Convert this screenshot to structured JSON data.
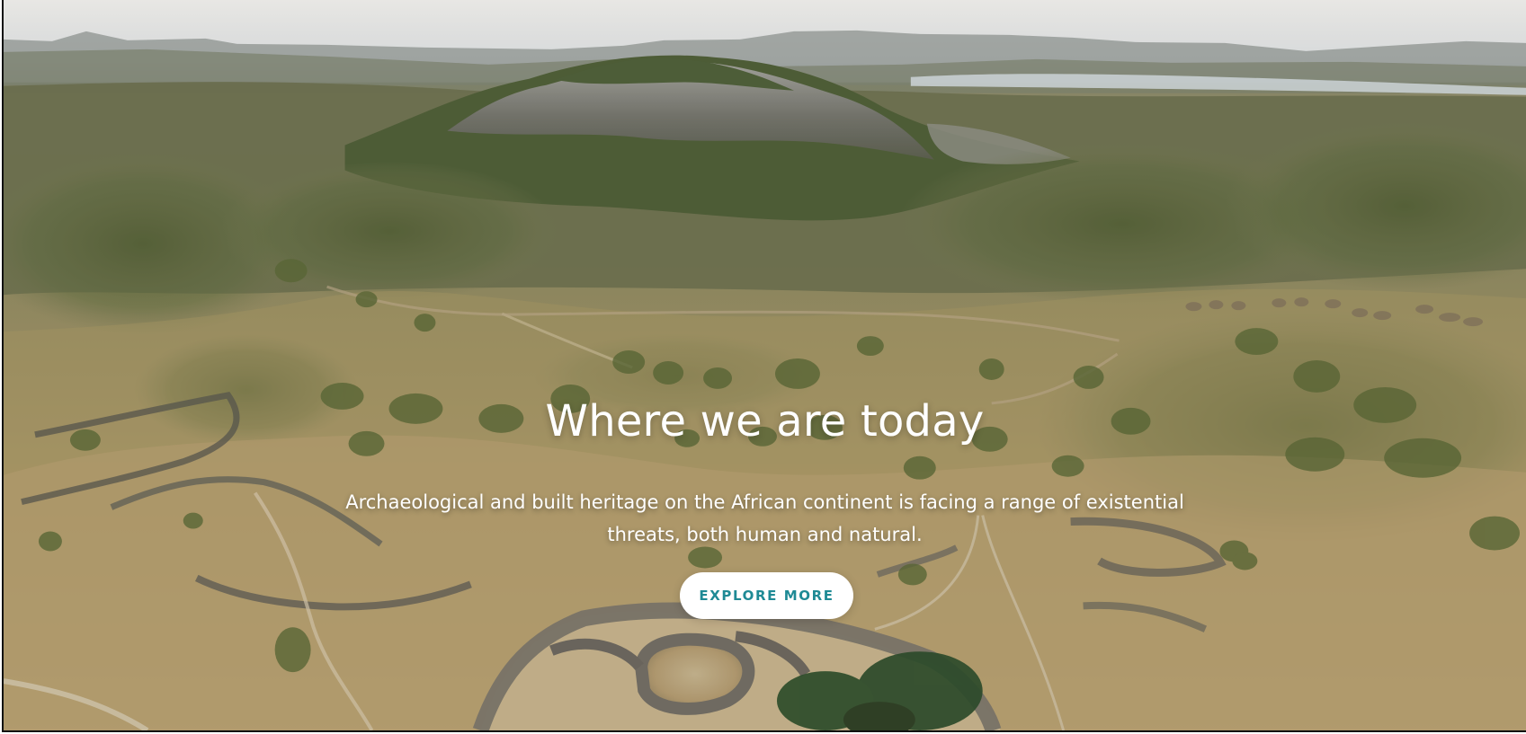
{
  "hero": {
    "title": "Where we are today",
    "subtitle": "Archaeological and built heritage on the African continent is facing a range of existential threats, both human and natural.",
    "button_label": "EXPLORE MORE"
  },
  "colors": {
    "button_text": "#1f8a95",
    "button_background": "#ffffff",
    "text": "#ffffff"
  }
}
